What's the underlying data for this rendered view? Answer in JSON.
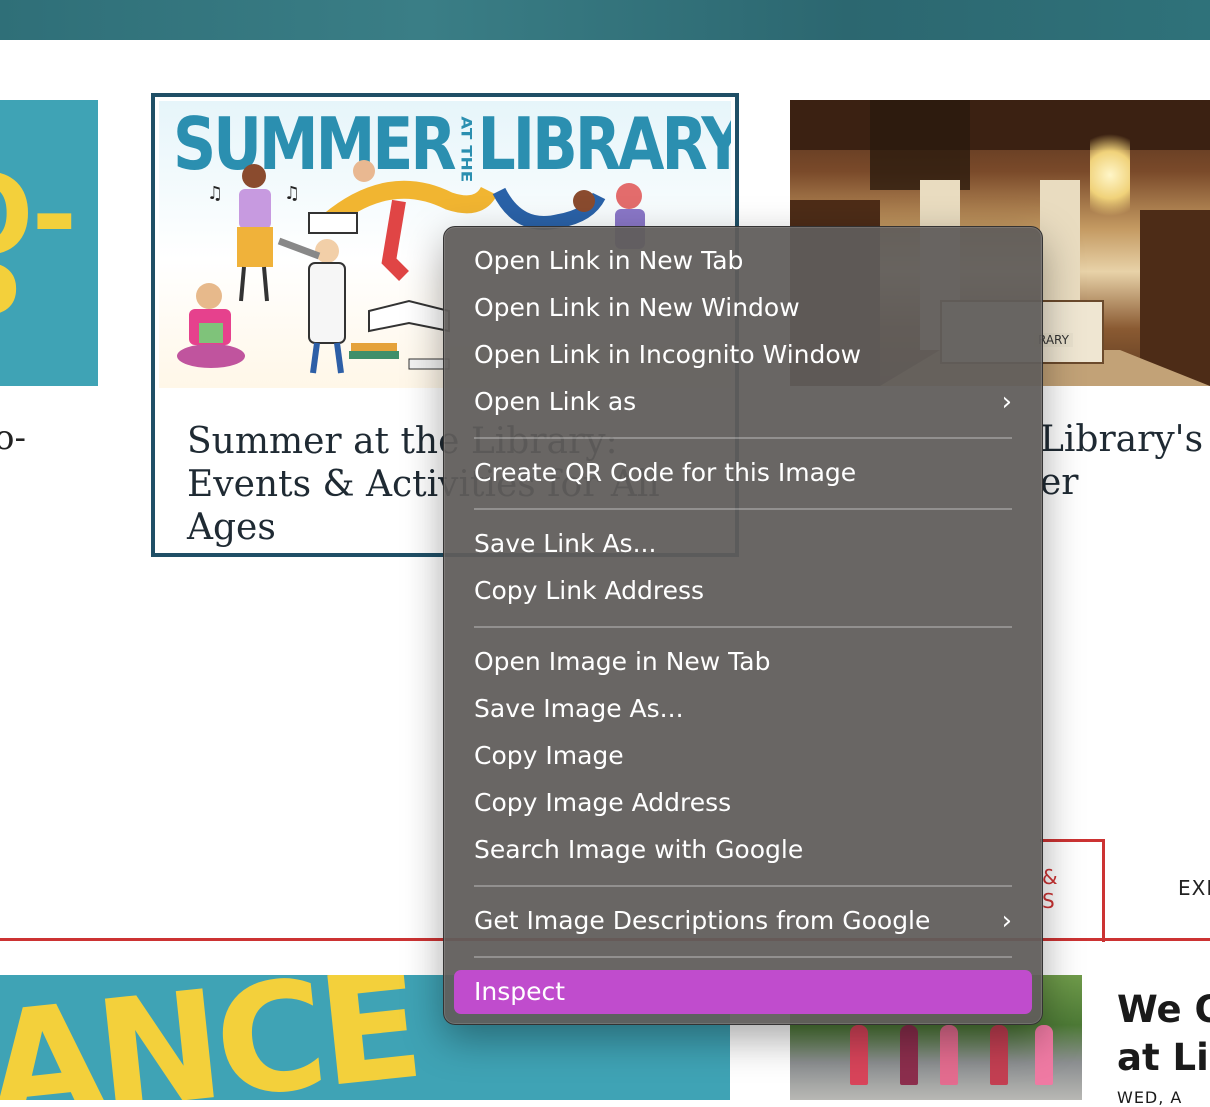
{
  "left_card": {
    "image_text": "O-\nP",
    "caption": "o-"
  },
  "summer_card": {
    "image_title_left": "SUMMER",
    "image_title_mid": "AT THE",
    "image_title_right": "LIBRARY",
    "title": "Summer at the Library: Events & Activities for All Ages"
  },
  "right_card": {
    "sign": "RARY",
    "caption": "Library's N\ner"
  },
  "tabs": {
    "active_label": "&\nS",
    "next_label": "EXI"
  },
  "bottom_left_card": {
    "image_text": "ANCE"
  },
  "bottom_right": {
    "title": "We O\nat Lir",
    "date": "WED, A"
  },
  "context_menu": {
    "groups": [
      [
        {
          "label": "Open Link in New Tab"
        },
        {
          "label": "Open Link in New Window"
        },
        {
          "label": "Open Link in Incognito Window"
        },
        {
          "label": "Open Link as",
          "submenu": true
        }
      ],
      [
        {
          "label": "Create QR Code for this Image"
        }
      ],
      [
        {
          "label": "Save Link As..."
        },
        {
          "label": "Copy Link Address"
        }
      ],
      [
        {
          "label": "Open Image in New Tab"
        },
        {
          "label": "Save Image As..."
        },
        {
          "label": "Copy Image"
        },
        {
          "label": "Copy Image Address"
        },
        {
          "label": "Search Image with Google"
        }
      ],
      [
        {
          "label": "Get Image Descriptions from Google",
          "submenu": true
        }
      ],
      [
        {
          "label": "Inspect",
          "highlighted": true
        }
      ]
    ],
    "submenu_glyph": "›",
    "highlight_color": "#c04ccd"
  }
}
